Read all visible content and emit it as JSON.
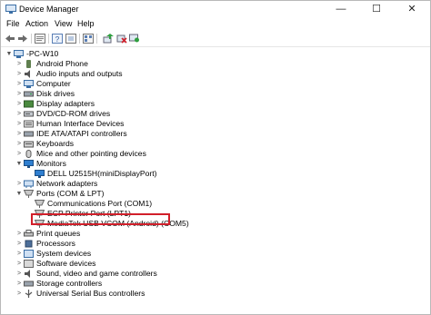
{
  "window": {
    "title": "Device Manager",
    "controls": {
      "minimize": "—",
      "maximize": "☐",
      "close": "✕"
    }
  },
  "menu": [
    "File",
    "Action",
    "View",
    "Help"
  ],
  "toolbar": {
    "icons": [
      "back-arrow-icon",
      "forward-arrow-icon",
      "properties-icon",
      "help-icon",
      "show-hidden-icon",
      "view-icon",
      "update-driver-icon",
      "uninstall-icon",
      "scan-hardware-icon"
    ]
  },
  "tree": {
    "root": "-PC-W10",
    "categories": [
      {
        "label": "Android Phone",
        "expanded": false
      },
      {
        "label": "Audio inputs and outputs",
        "expanded": false
      },
      {
        "label": "Computer",
        "expanded": false
      },
      {
        "label": "Disk drives",
        "expanded": false
      },
      {
        "label": "Display adapters",
        "expanded": false
      },
      {
        "label": "DVD/CD-ROM drives",
        "expanded": false
      },
      {
        "label": "Human Interface Devices",
        "expanded": false
      },
      {
        "label": "IDE ATA/ATAPI controllers",
        "expanded": false
      },
      {
        "label": "Keyboards",
        "expanded": false
      },
      {
        "label": "Mice and other pointing devices",
        "expanded": false
      },
      {
        "label": "Monitors",
        "expanded": true,
        "children": [
          "DELL U2515H(miniDisplayPort)"
        ]
      },
      {
        "label": "Network adapters",
        "expanded": false
      },
      {
        "label": "Ports (COM & LPT)",
        "expanded": true,
        "children": [
          "Communications Port (COM1)",
          "ECP Printer Port (LPT1)",
          "MediaTek USB VCOM (Android) (COM5)"
        ]
      },
      {
        "label": "Print queues",
        "expanded": false
      },
      {
        "label": "Processors",
        "expanded": false
      },
      {
        "label": "System devices",
        "expanded": false
      },
      {
        "label": "Software devices",
        "expanded": false
      },
      {
        "label": "Sound, video and game controllers",
        "expanded": false
      },
      {
        "label": "Storage controllers",
        "expanded": false
      },
      {
        "label": "Universal Serial Bus controllers",
        "expanded": false
      }
    ]
  },
  "colors": {
    "highlight_border": "#d11f2a",
    "accent": "#1e6fd6"
  }
}
